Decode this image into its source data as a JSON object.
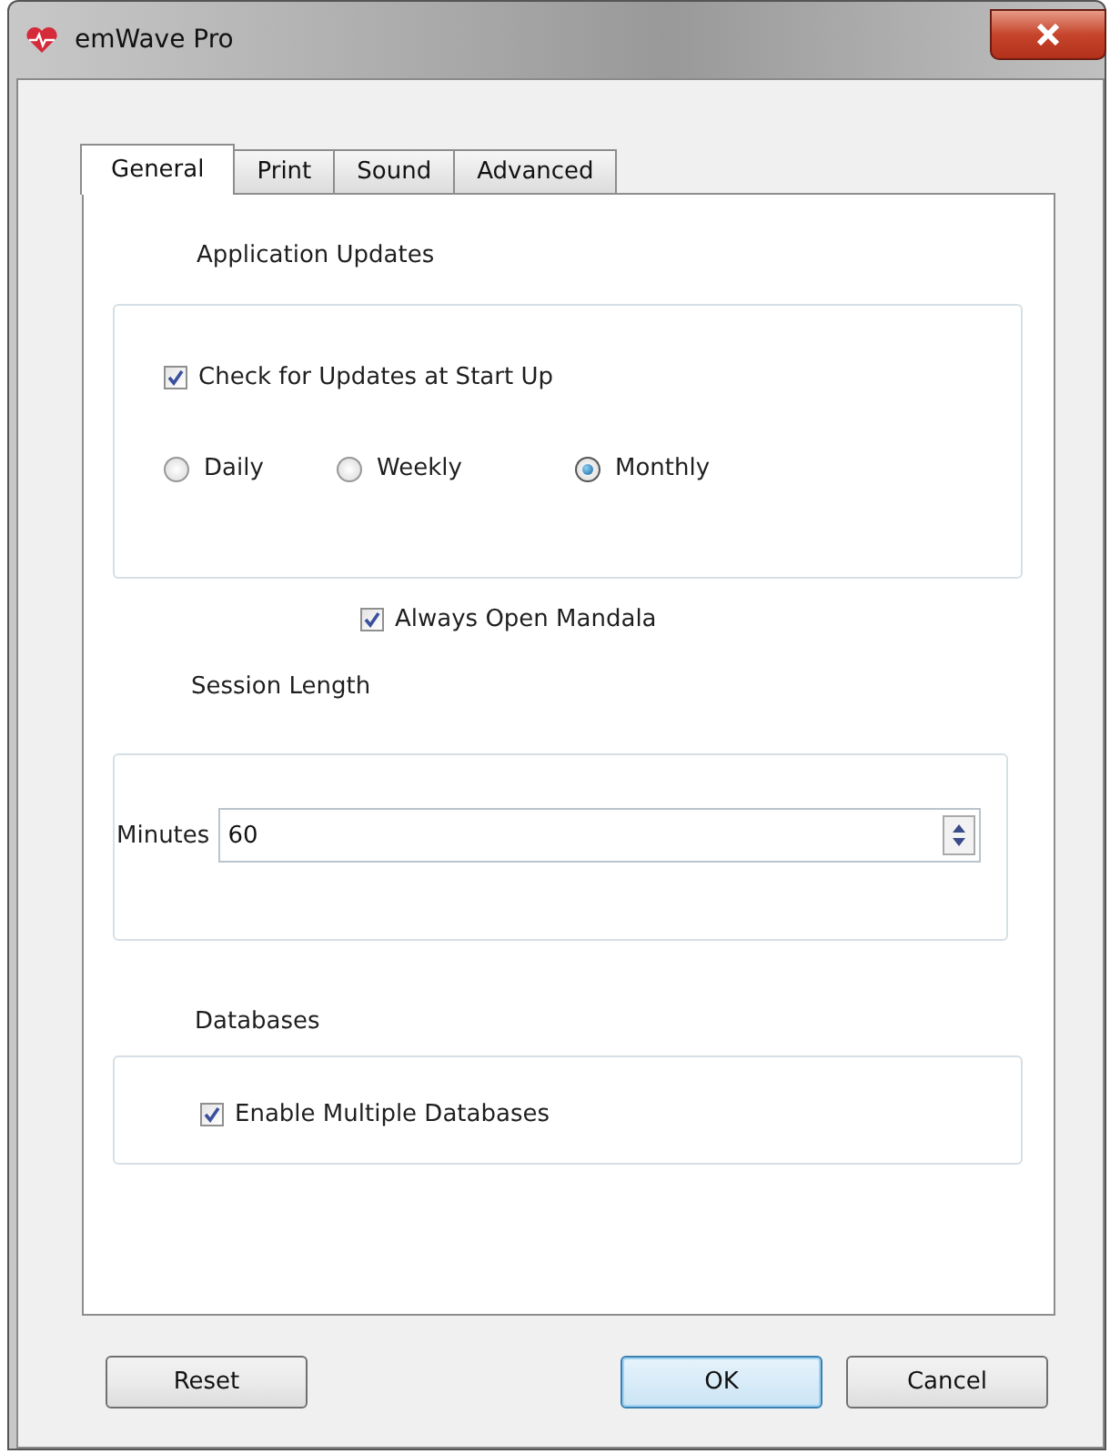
{
  "window": {
    "title": "emWave Pro"
  },
  "tabs": [
    {
      "label": "General",
      "selected": true
    },
    {
      "label": "Print",
      "selected": false
    },
    {
      "label": "Sound",
      "selected": false
    },
    {
      "label": "Advanced",
      "selected": false
    }
  ],
  "application_updates": {
    "heading": "Application Updates",
    "check_updates": {
      "label": "Check for Updates at Start Up",
      "checked": true
    },
    "frequency": [
      {
        "label": "Daily",
        "selected": false
      },
      {
        "label": "Weekly",
        "selected": false
      },
      {
        "label": "Monthly",
        "selected": true
      }
    ]
  },
  "always_open_mandala": {
    "label": "Always Open Mandala",
    "checked": true
  },
  "session_length": {
    "heading": "Session Length",
    "field_label": "Minutes",
    "value": "60"
  },
  "databases": {
    "heading": "Databases",
    "enable_multiple": {
      "label": "Enable Multiple Databases",
      "checked": true
    }
  },
  "buttons": [
    {
      "label": "Reset",
      "default": false
    },
    {
      "label": "OK",
      "default": true
    },
    {
      "label": "Cancel",
      "default": false
    }
  ]
}
